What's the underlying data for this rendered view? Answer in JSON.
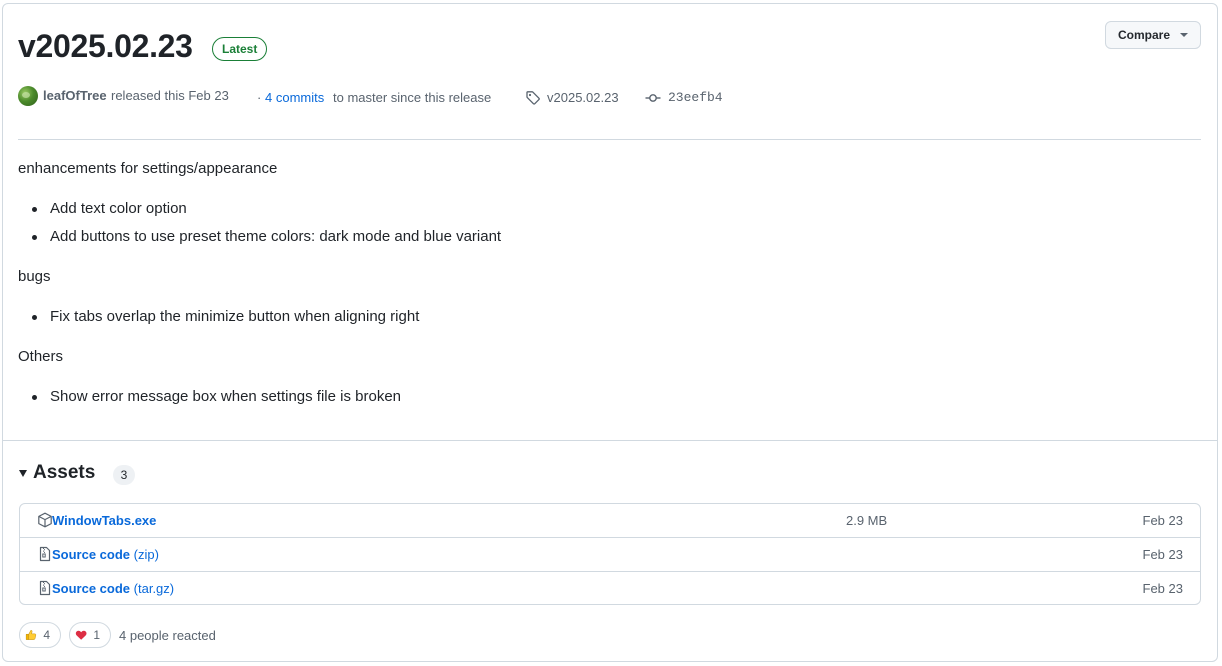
{
  "release": {
    "title": "v2025.02.23",
    "badge": "Latest",
    "compare_label": "Compare"
  },
  "meta": {
    "author": "leafOfTree",
    "released_text": "released this Feb 23",
    "commits_prefix": "·",
    "commits_link": "4 commits",
    "commits_suffix": "to master since this release",
    "tag": "v2025.02.23",
    "commit_sha": "23eefb4"
  },
  "notes": {
    "section1_heading": "enhancements for settings/appearance",
    "section1_items": [
      "Add text color option",
      "Add buttons to use preset theme colors: dark mode and blue variant"
    ],
    "section2_heading": "bugs",
    "section2_items": [
      "Fix tabs overlap the minimize button when aligning right"
    ],
    "section3_heading": "Others",
    "section3_items": [
      "Show error message box when settings file is broken"
    ]
  },
  "assets": {
    "heading": "Assets",
    "count": "3",
    "items": [
      {
        "name": "WindowTabs.exe",
        "suffix": "",
        "size": "2.9 MB",
        "date": "Feb 23",
        "icon": "package-icon"
      },
      {
        "name": "Source code",
        "suffix": "(zip)",
        "size": "",
        "date": "Feb 23",
        "icon": "file-zip-icon"
      },
      {
        "name": "Source code",
        "suffix": "(tar.gz)",
        "size": "",
        "date": "Feb 23",
        "icon": "file-zip-icon"
      }
    ]
  },
  "reactions": {
    "thumbs_up_count": "4",
    "heart_count": "1",
    "summary": "4 people reacted"
  },
  "colors": {
    "link": "#0969da",
    "latest_badge": "#1a7f37",
    "border": "#d1d9e0",
    "muted": "#59636e"
  }
}
